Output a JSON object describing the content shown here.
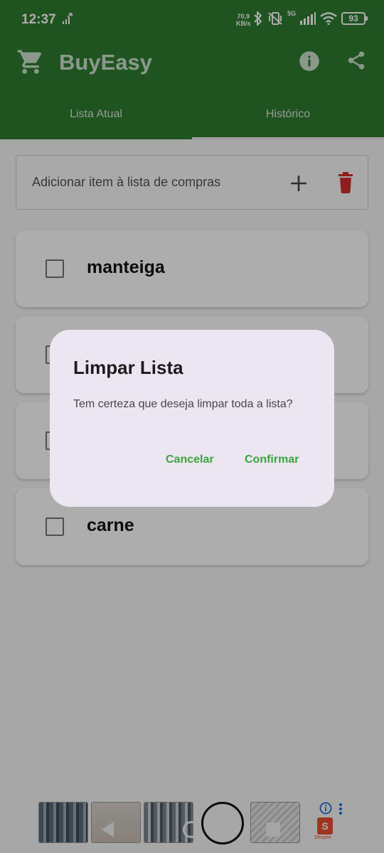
{
  "status_bar": {
    "time": "12:37",
    "speed_value": "70,9",
    "speed_unit": "KB/s",
    "network": "5G",
    "battery": "93"
  },
  "app_bar": {
    "title": "BuyEasy",
    "icons": [
      "cart-icon",
      "info-icon",
      "share-icon"
    ],
    "color": "#2f7d32"
  },
  "tabs": [
    {
      "label": "Lista Atual",
      "active": false
    },
    {
      "label": "Histórico",
      "active": true
    }
  ],
  "add_item": {
    "placeholder": "Adicionar item à lista de compras",
    "add_icon": "plus-icon",
    "clear_icon": "trash-icon",
    "clear_color": "#d32f2f"
  },
  "items": [
    {
      "label": "manteiga",
      "checked": false
    },
    {
      "label": "",
      "checked": false
    },
    {
      "label": "",
      "checked": false
    },
    {
      "label": "carne",
      "checked": false
    }
  ],
  "dialog": {
    "title": "Limpar Lista",
    "message": "Tem certeza que deseja limpar toda a lista?",
    "cancel_label": "Cancelar",
    "confirm_label": "Confirmar",
    "button_color": "#3aa53f"
  },
  "dock": {
    "shopee_label": "Shopee"
  }
}
